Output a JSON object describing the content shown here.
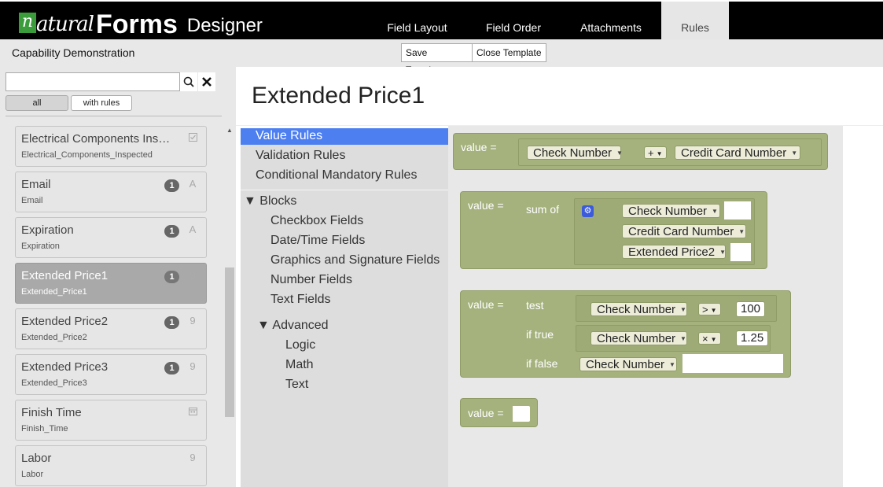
{
  "logo": {
    "n": "n",
    "natural": "atural",
    "forms": "Forms",
    "designer": "Designer"
  },
  "tabs": [
    {
      "label": "Field Layout"
    },
    {
      "label": "Field Order"
    },
    {
      "label": "Attachments"
    },
    {
      "label": "Rules"
    }
  ],
  "app": {
    "name": "Capability Demonstration"
  },
  "template_buttons": {
    "save": "Save Template",
    "close": "Close Template"
  },
  "search": {
    "value": "",
    "placeholder": ""
  },
  "filters": {
    "all": "all",
    "with_rules": "with rules"
  },
  "fields": [
    {
      "label": "Electrical Components Ins…",
      "name": "Electrical_Components_Inspected",
      "badge": "",
      "type_icon": "checkbox-icon"
    },
    {
      "label": "Email",
      "name": "Email",
      "badge": "1",
      "type_icon": "text-field-icon"
    },
    {
      "label": "Expiration",
      "name": "Expiration",
      "badge": "1",
      "type_icon": "text-field-icon"
    },
    {
      "label": "Extended Price1",
      "name": "Extended_Price1",
      "badge": "1",
      "type_icon": "number-field-icon"
    },
    {
      "label": "Extended Price2",
      "name": "Extended_Price2",
      "badge": "1",
      "type_icon": "number-field-icon"
    },
    {
      "label": "Extended Price3",
      "name": "Extended_Price3",
      "badge": "1",
      "type_icon": "number-field-icon"
    },
    {
      "label": "Finish Time",
      "name": "Finish_Time",
      "badge": "",
      "type_icon": "calendar-icon"
    },
    {
      "label": "Labor",
      "name": "Labor",
      "badge": "",
      "type_icon": "number-field-icon"
    }
  ],
  "rule_title": "Extended Price1",
  "toolbox": {
    "value_rules": "Value Rules",
    "validation_rules": "Validation Rules",
    "conditional_rules": "Conditional Mandatory Rules",
    "blocks": "Blocks",
    "checkbox": "Checkbox Fields",
    "datetime": "Date/Time Fields",
    "graphics": "Graphics and Signature Fields",
    "number": "Number Fields",
    "text": "Text Fields",
    "advanced": "Advanced",
    "logic": "Logic",
    "math": "Math",
    "text2": "Text"
  },
  "blocks": {
    "value_label": "value =",
    "b1": {
      "f1": "Check Number",
      "op": "+",
      "f2": "Credit Card Number"
    },
    "b2": {
      "sum_of": "sum of",
      "f1": "Check Number",
      "f2": "Credit Card Number",
      "f3": "Extended Price2"
    },
    "b3": {
      "test": "test",
      "if_true": "if true",
      "if_false": "if false",
      "f1": "Check Number",
      "op1": ">",
      "n1": "100",
      "f2": "Check Number",
      "op2": "×",
      "n2": "1.25",
      "f3": "Check Number"
    }
  },
  "colors": {
    "block": "#a5b27e",
    "selected": "#4d7ff0",
    "topbar": "#000000",
    "logo_n": "#3a9c3a"
  }
}
